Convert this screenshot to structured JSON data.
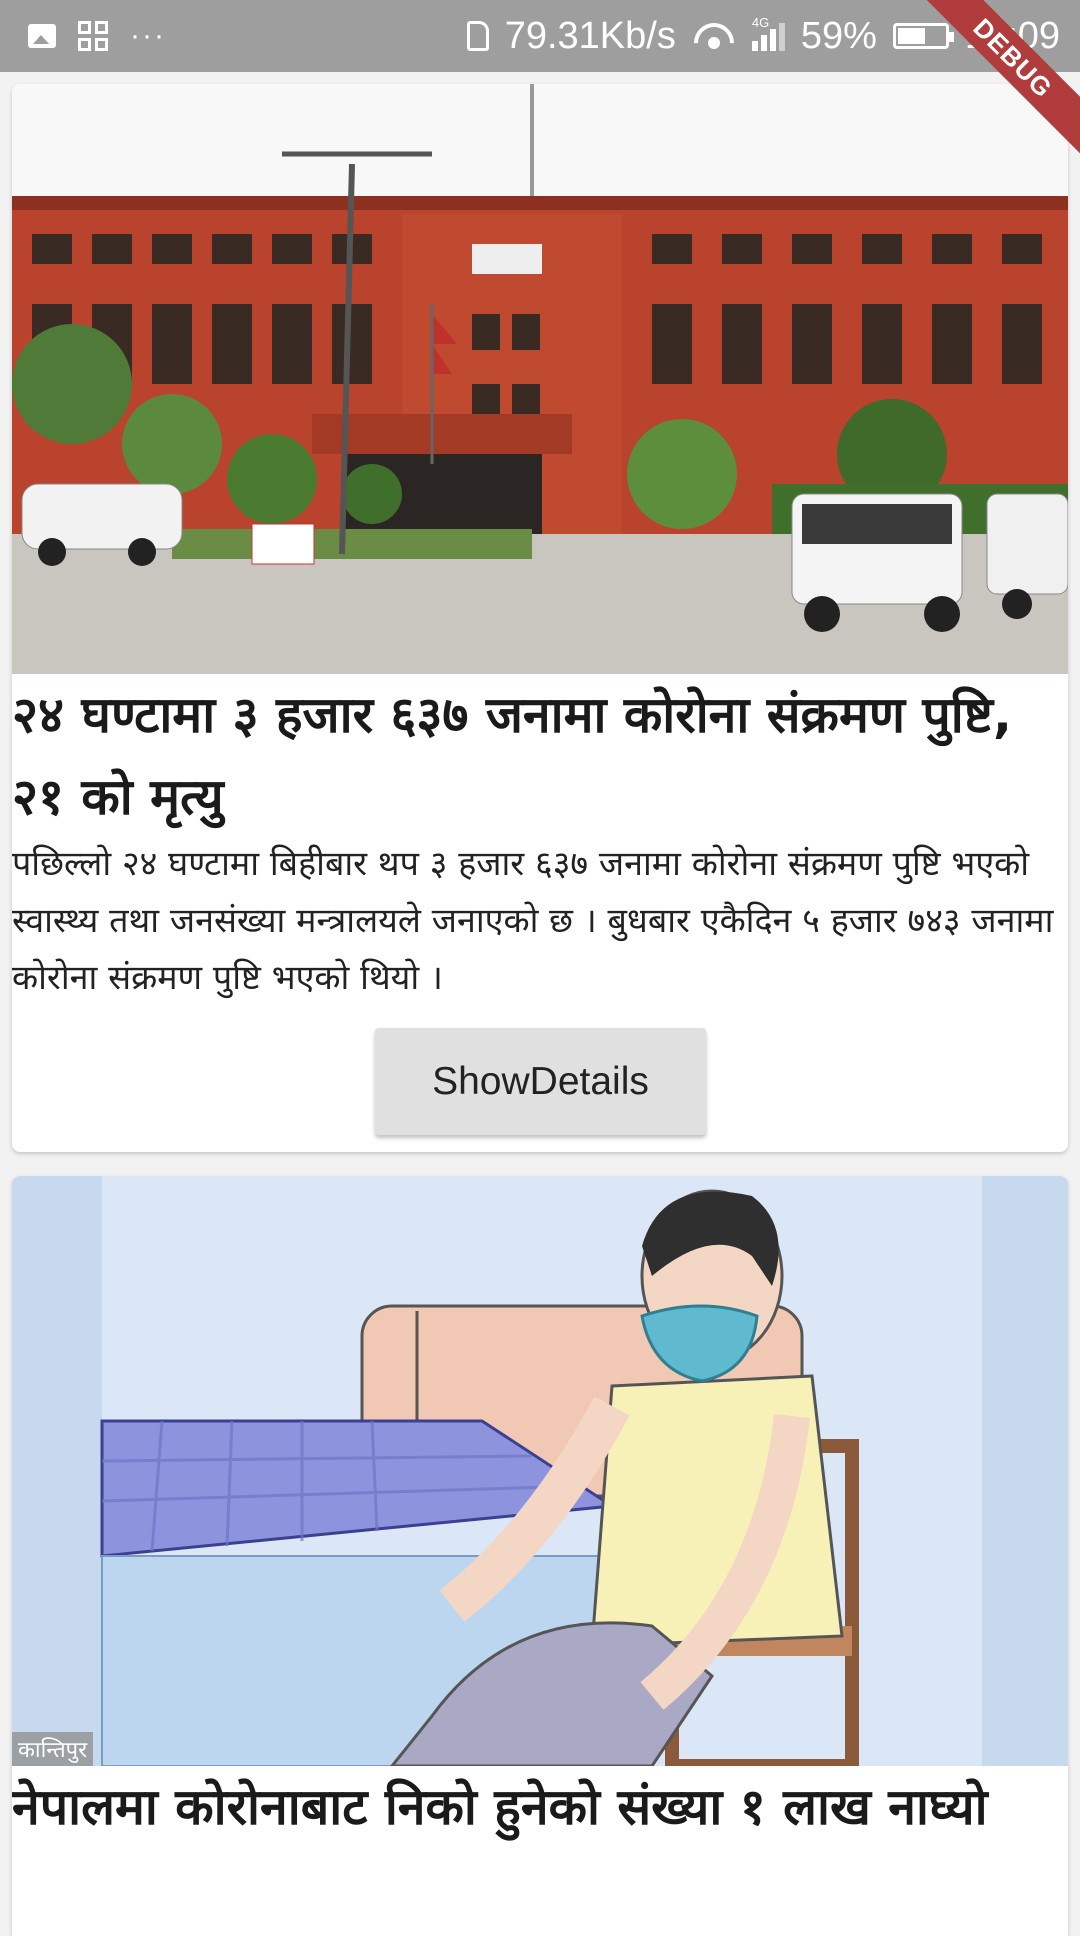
{
  "status_bar": {
    "network_speed": "79.31Kb/s",
    "network_type": "4G",
    "battery_percent": "59%",
    "battery_level": 0.59,
    "time": "19:09",
    "more_indicator": "···"
  },
  "debug_banner": "DEBUG",
  "articles": [
    {
      "title": "२४ घण्टामा ३ हजार ६३७ जनामा कोरोना संक्रमण पुष्टि, २१ को मृत्यु",
      "description": "पछिल्लो २४ घण्टामा बिहीबार थप ३ हजार ६३७ जनामा कोरोना संक्रमण पुष्टि भएको स्वास्थ्य तथा जनसंख्या मन्त्रालयले जनाएको छ । बुधबार एकैदिन ५ हजार ७४३ जनामा कोरोना संक्रमण पुष्टि भएको थियो ।",
      "button_label": "ShowDetails"
    },
    {
      "title": "नेपालमा कोरोनाबाट निको हुनेको संख्या १ लाख नाघ्यो",
      "image_watermark": "कान्तिपुर"
    }
  ]
}
